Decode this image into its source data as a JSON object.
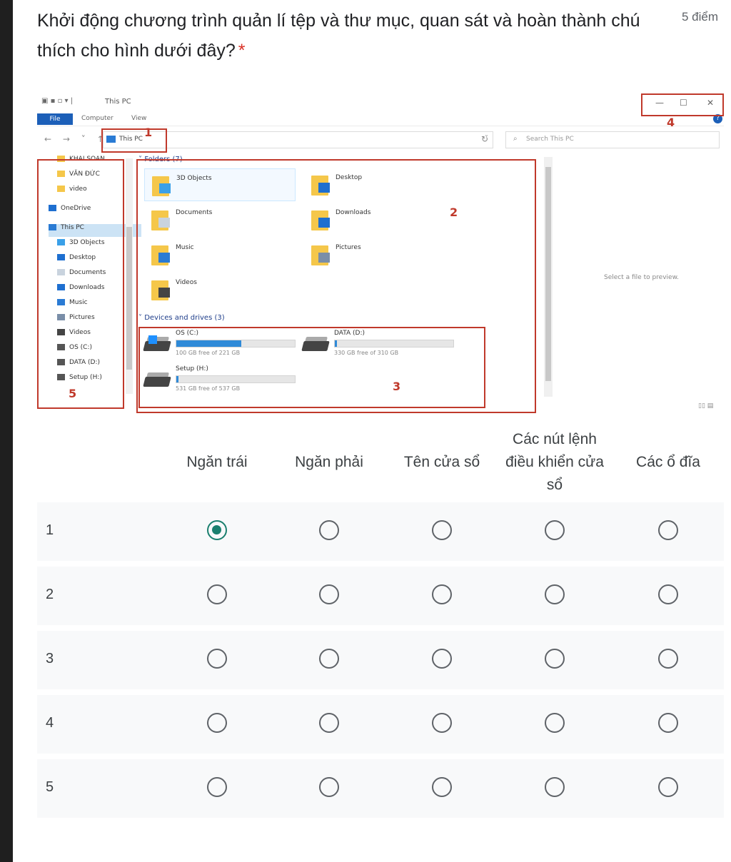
{
  "question": {
    "text": "Khởi động chương trình quản lí tệp và thư mục, quan sát và hoàn thành chú thích cho hình dưới đây?",
    "required_mark": "*",
    "points": "5 điểm"
  },
  "explorer": {
    "title": "This PC",
    "ribbon_tabs": [
      "File",
      "Computer",
      "View"
    ],
    "address": "This PC",
    "search_placeholder": "Search This PC",
    "nav_items": [
      {
        "label": "KHAI SOAN",
        "icon": "folder"
      },
      {
        "label": "VĂN ĐỨC",
        "icon": "folder"
      },
      {
        "label": "video",
        "icon": "folder"
      },
      {
        "label": "OneDrive",
        "icon": "cloud"
      },
      {
        "label": "This PC",
        "icon": "pc"
      },
      {
        "label": "3D Objects",
        "icon": "cube"
      },
      {
        "label": "Desktop",
        "icon": "desktop"
      },
      {
        "label": "Documents",
        "icon": "document"
      },
      {
        "label": "Downloads",
        "icon": "download"
      },
      {
        "label": "Music",
        "icon": "music"
      },
      {
        "label": "Pictures",
        "icon": "picture"
      },
      {
        "label": "Videos",
        "icon": "video"
      },
      {
        "label": "OS (C:)",
        "icon": "drive"
      },
      {
        "label": "DATA (D:)",
        "icon": "drive"
      },
      {
        "label": "Setup (H:)",
        "icon": "drive"
      }
    ],
    "folders_header": "Folders (7)",
    "folders": [
      "3D Objects",
      "Desktop",
      "Documents",
      "Downloads",
      "Music",
      "Pictures",
      "Videos"
    ],
    "drives_header": "Devices and drives (3)",
    "drives": [
      {
        "name": "OS (C:)",
        "free": "100 GB free of 221 GB",
        "used_fraction": 0.55
      },
      {
        "name": "DATA (D:)",
        "free": "330 GB free of 310 GB",
        "used_fraction": 0.02
      },
      {
        "name": "Setup (H:)",
        "free": "531 GB free of 537 GB",
        "used_fraction": 0.02
      }
    ],
    "preview_text": "Select a file to preview.",
    "annotations": [
      "1",
      "2",
      "3",
      "4",
      "5"
    ]
  },
  "grid": {
    "columns": [
      "Ngăn trái",
      "Ngăn phải",
      "Tên cửa sổ",
      "Các nút lệnh điều khiển cửa sổ",
      "Các ổ đĩa"
    ],
    "rows": [
      "1",
      "2",
      "3",
      "4",
      "5"
    ],
    "selected": {
      "row": 0,
      "column": 0
    },
    "accent_color": "#1a7f6e"
  }
}
